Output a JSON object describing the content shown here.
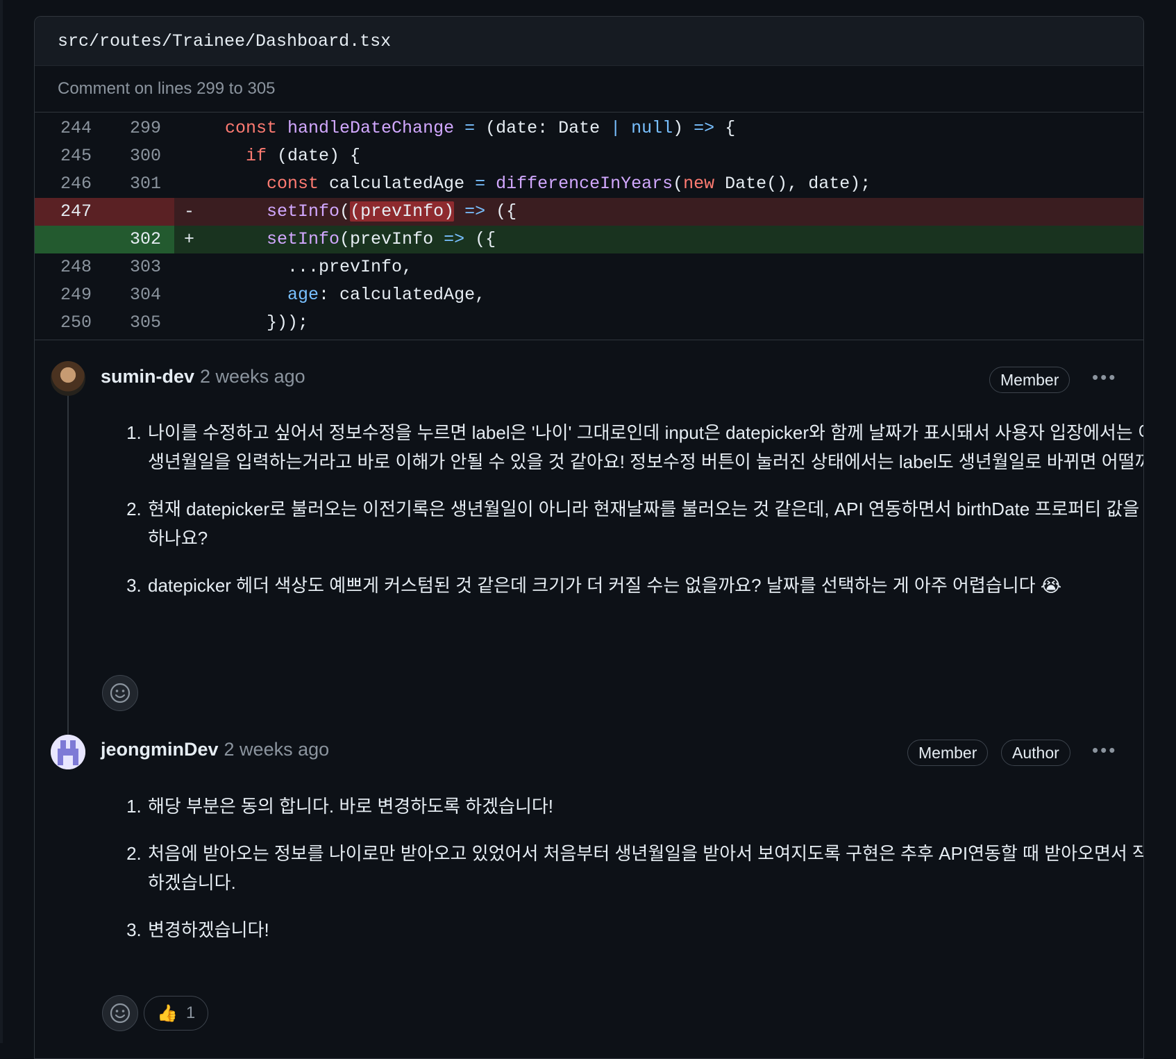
{
  "file": {
    "path": "src/routes/Trainee/Dashboard.tsx"
  },
  "comment_scope": "Comment on lines 299 to 305",
  "diff_rows": [
    {
      "old": "244",
      "new": "299",
      "marker": ""
    },
    {
      "old": "245",
      "new": "300",
      "marker": ""
    },
    {
      "old": "246",
      "new": "301",
      "marker": ""
    },
    {
      "old": "247",
      "new": "",
      "marker": "-"
    },
    {
      "old": "",
      "new": "302",
      "marker": "+"
    },
    {
      "old": "248",
      "new": "303",
      "marker": ""
    },
    {
      "old": "249",
      "new": "304",
      "marker": ""
    },
    {
      "old": "250",
      "new": "305",
      "marker": ""
    }
  ],
  "code": {
    "l1": {
      "kw": "const",
      "fn": "handleDateChange",
      "eq": " = ",
      "rest1": "(date: Date ",
      "pipe": "|",
      "nul": " null",
      "rest2": ") ",
      "arrow": "=>",
      "rest3": " {"
    },
    "l2": {
      "kw": "if",
      "rest": " (date) {"
    },
    "l3": {
      "kw": "const",
      "var": " calculatedAge ",
      "eq": "=",
      "fn": " differenceInYears",
      "paren": "(",
      "new": "new",
      "rest": " Date(), date);"
    },
    "l4": {
      "fn": "setInfo",
      "p1": "(",
      "hl": "(prevInfo)",
      "arrow": " =>",
      "rest": " ({"
    },
    "l5": {
      "fn": "setInfo",
      "p1": "(prevInfo ",
      "arrow": "=>",
      "rest": " ({"
    },
    "l6": {
      "rest": "...prevInfo,"
    },
    "l7": {
      "prop": "age",
      "rest": ": calculatedAge,"
    },
    "l8": {
      "rest": "}));"
    }
  },
  "comments": [
    {
      "author": "sumin-dev",
      "time": "2 weeks ago",
      "badges": [
        "Member"
      ],
      "more": "•••",
      "items": [
        "나이를 수정하고 싶어서 정보수정을 누르면 label은 '나이' 그대로인데 input은 datepicker와 함께 날짜가 표시돼서 사용자 입장에서는 이게 생년월일을 입력하는거라고 바로 이해가 안될 수 있을 것 같아요! 정보수정 버튼이 눌러진 상태에서는 label도 생년월일로 바뀌면 어떨까요?",
        "현재 datepicker로 불러오는 이전기록은 생년월일이 아니라 현재날짜를 불러오는 것 같은데, API 연동하면서 birthDate 프로퍼티 값을 사용하나요?",
        "datepicker 헤더 색상도 예쁘게 커스텀된 것 같은데 크기가 더 커질 수는 없을까요? 날짜를 선택하는 게 아주 어렵습니다 😭"
      ]
    },
    {
      "author": "jeongminDev",
      "time": "2 weeks ago",
      "badges": [
        "Member",
        "Author"
      ],
      "more": "•••",
      "items": [
        "해당 부분은 동의 합니다. 바로 변경하도록 하겠습니다!",
        "처음에 받아오는 정보를 나이로만 받아오고 있었어서 처음부터 생년월일을 받아서 보여지도록 구현은 추후 API연동할 때 받아오면서 작업 하겠습니다.",
        "변경하겠습니다!"
      ],
      "reactions": [
        {
          "emoji": "👍",
          "count": "1"
        }
      ]
    }
  ],
  "icons": {
    "reaction": "smiley-icon",
    "thumbs_up": "thumbs-up-icon"
  }
}
